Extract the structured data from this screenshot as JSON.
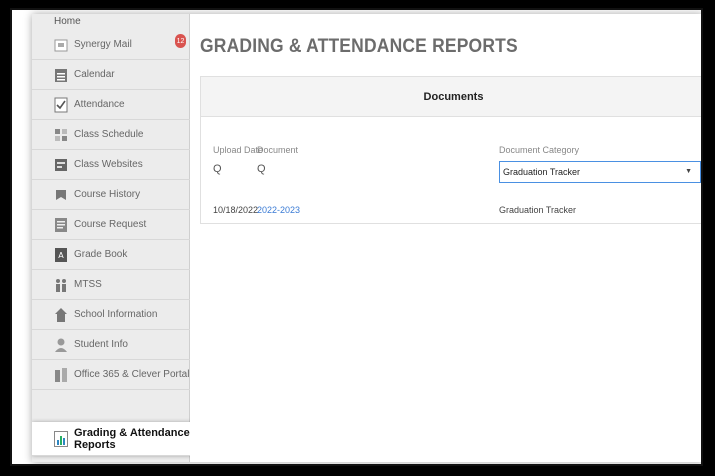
{
  "sidebar": {
    "home": "Home",
    "items": [
      {
        "label": "Synergy Mail",
        "icon": "mail-icon",
        "badge": "12"
      },
      {
        "label": "Calendar",
        "icon": "calendar-icon"
      },
      {
        "label": "Attendance",
        "icon": "attendance-icon"
      },
      {
        "label": "Class Schedule",
        "icon": "schedule-icon"
      },
      {
        "label": "Class Websites",
        "icon": "websites-icon"
      },
      {
        "label": "Course History",
        "icon": "history-icon"
      },
      {
        "label": "Course Request",
        "icon": "request-icon"
      },
      {
        "label": "Grade Book",
        "icon": "gradebook-icon"
      },
      {
        "label": "MTSS",
        "icon": "mtss-icon"
      },
      {
        "label": "School Information",
        "icon": "school-icon"
      },
      {
        "label": "Student Info",
        "icon": "student-icon"
      },
      {
        "label": "Office 365 & Clever Portal",
        "icon": "office-icon"
      },
      {
        "label": "Grading & Attendance Reports",
        "icon": "reports-icon",
        "active": true
      }
    ]
  },
  "main": {
    "title": "GRADING & ATTENDANCE REPORTS",
    "panel_title": "Documents",
    "columns": {
      "upload_date": "Upload Date",
      "document": "Document",
      "category": "Document Category"
    },
    "filters": {
      "upload_date": "Q",
      "document": "Q",
      "category_selected": "Graduation Tracker"
    },
    "rows": [
      {
        "upload_date": "10/18/2022",
        "document": "2022-2023",
        "category": "Graduation Tracker"
      }
    ]
  },
  "colors": {
    "accent": "#3a7bd5",
    "badge": "#d9534f"
  }
}
